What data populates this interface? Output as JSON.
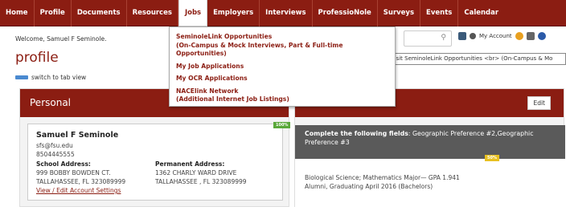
{
  "nav": {
    "items": [
      "Home",
      "Profile",
      "Documents",
      "Resources",
      "Jobs",
      "Employers",
      "Interviews",
      "ProfessioNole",
      "Surveys",
      "Events",
      "Calendar"
    ],
    "active": "Jobs"
  },
  "welcome": "Welcome, Samuel F Seminole.",
  "account_label": "My Account",
  "page_title": "profile",
  "switch_label": "switch to tab view",
  "tooltip": "Visit SeminoleLink Opportunities <br> (On-Campus & Mo",
  "jobs_menu": [
    {
      "line1": "SeminoleLink Opportunities",
      "line2": "(On-Campus & Mock Interviews, Part & Full-time Opportunities)"
    },
    {
      "line1": "My Job Applications",
      "line2": ""
    },
    {
      "line1": "My OCR Applications",
      "line2": ""
    },
    {
      "line1": "NACElink Network",
      "line2": "(Additional Internet Job Listings)"
    }
  ],
  "personal": {
    "header": "Personal",
    "badge": "100%",
    "name": "Samuel F Seminole",
    "email": "sfs@fsu.edu",
    "phone": "8504445555",
    "school_label": "School Address:",
    "school_line1": "999 BOBBY BOWDEN CT.",
    "school_line2": "TALLAHASSEE, FL 323089999",
    "perm_label": "Permanent Address:",
    "perm_line1": "1362 CHARLY WARD DRIVE",
    "perm_line2": "TALLAHASSEE , FL 323089999",
    "link": "View / Edit Account Settings"
  },
  "academic": {
    "edit_label": "Edit",
    "badge": "50%",
    "complete_label": "Complete the following fields",
    "complete_fields": ": Geographic Preference #2,Geographic Preference #3",
    "major_line": "Biological Science; Mathematics Major— GPA 1.941",
    "grad_line": "Alumni, Graduating April 2016 (Bachelors)"
  },
  "colors": {
    "brand": "#8b1d12",
    "dark_panel": "#5a5a5a",
    "badge_green": "#5aa83a",
    "badge_yellow": "#e8c020"
  }
}
